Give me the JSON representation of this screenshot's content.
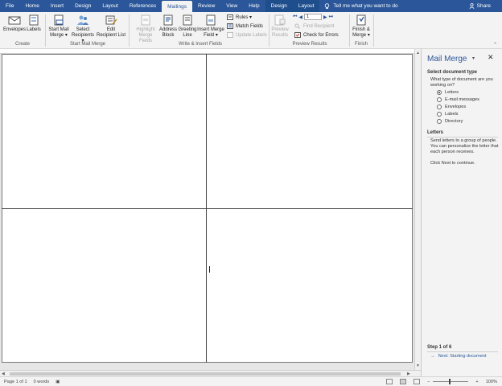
{
  "tabs": [
    {
      "label": "File",
      "active": false
    },
    {
      "label": "Home",
      "active": false
    },
    {
      "label": "Insert",
      "active": false
    },
    {
      "label": "Design",
      "active": false
    },
    {
      "label": "Layout",
      "active": false
    },
    {
      "label": "References",
      "active": false
    },
    {
      "label": "Mailings",
      "active": true
    },
    {
      "label": "Review",
      "active": false
    },
    {
      "label": "View",
      "active": false
    },
    {
      "label": "Help",
      "active": false
    },
    {
      "label": "Design",
      "active": false
    },
    {
      "label": "Layout",
      "active": false
    }
  ],
  "tell_me": "Tell me what you want to do",
  "share_label": "Share",
  "ribbon": {
    "create": {
      "envelopes": "Envelopes",
      "labels": "Labels",
      "group": "Create"
    },
    "start": {
      "start_l1": "Start Mail",
      "start_l2": "Merge",
      "select_l1": "Select",
      "select_l2": "Recipients",
      "edit_l1": "Edit",
      "edit_l2": "Recipient List",
      "group": "Start Mail Merge"
    },
    "write": {
      "highlight_l1": "Highlight",
      "highlight_l2": "Merge Fields",
      "address_l1": "Address",
      "address_l2": "Block",
      "greeting_l1": "Greeting",
      "greeting_l2": "Line",
      "insert_l1": "Insert Merge",
      "insert_l2": "Field",
      "rules": "Rules",
      "match": "Match Fields",
      "update": "Update Labels",
      "group": "Write & Insert Fields"
    },
    "preview": {
      "preview_l1": "Preview",
      "preview_l2": "Results",
      "record_value": "1",
      "find": "Find Recipient",
      "check": "Check for Errors",
      "group": "Preview Results"
    },
    "finish": {
      "finish_l1": "Finish &",
      "finish_l2": "Merge",
      "group": "Finish"
    }
  },
  "pane": {
    "title": "Mail Merge",
    "select_heading": "Select document type",
    "question": "What type of document are you working on?",
    "options": [
      {
        "label": "Letters",
        "selected": true
      },
      {
        "label": "E-mail messages",
        "selected": false
      },
      {
        "label": "Envelopes",
        "selected": false
      },
      {
        "label": "Labels",
        "selected": false
      },
      {
        "label": "Directory",
        "selected": false
      }
    ],
    "letters_heading": "Letters",
    "letters_desc": "Send letters to a group of people. You can personalize the letter that each person receives.",
    "continue_text": "Click Next to continue.",
    "step": "Step 1 of 6",
    "next_link": "Next: Starting document"
  },
  "status": {
    "page": "Page 1 of 1",
    "words": "0 words",
    "zoom": "100%"
  },
  "colors": {
    "accent": "#2b579a"
  }
}
